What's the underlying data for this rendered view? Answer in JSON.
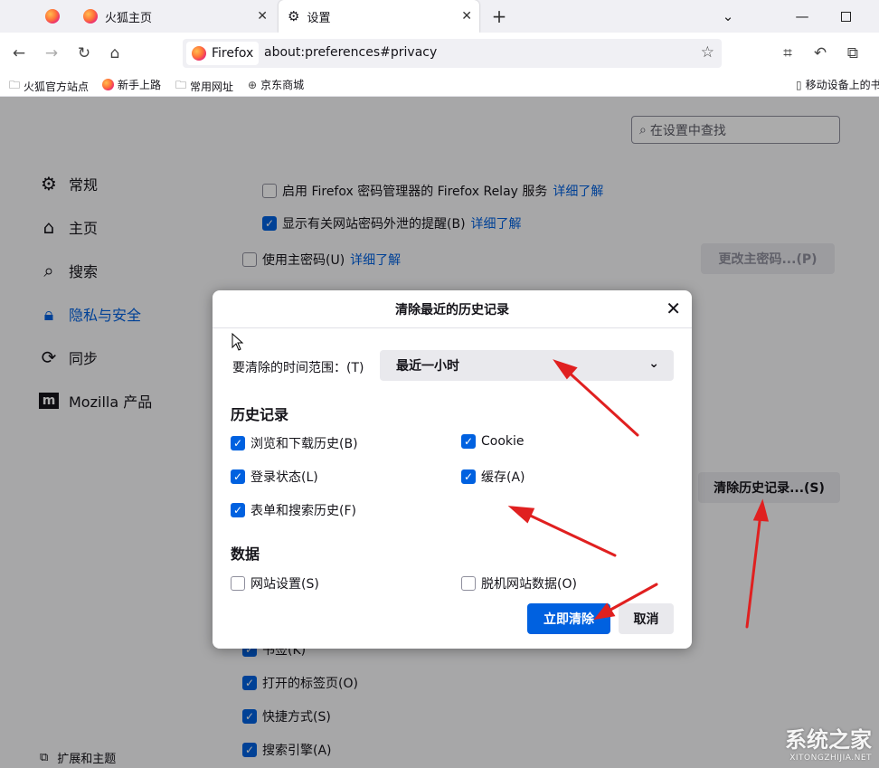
{
  "tabs": {
    "tab1_title": "火狐主页",
    "tab2_title": "设置"
  },
  "nav": {
    "identity_label": "Firefox",
    "url": "about:preferences#privacy"
  },
  "bookmarks": {
    "items": [
      "火狐官方站点",
      "新手上路",
      "常用网址",
      "京东商城"
    ],
    "mobile": "移动设备上的书签"
  },
  "page": {
    "search_placeholder": "在设置中查找",
    "categories": [
      "常规",
      "主页",
      "搜索",
      "隐私与安全",
      "同步",
      "Mozilla 产品"
    ],
    "extensions_label": "扩展和主题",
    "relay_label": "启用 Firefox 密码管理器的 Firefox Relay 服务",
    "breach_label": "显示有关网站密码外泄的提醒(B)",
    "primary_pw_label": "使用主密码(U)",
    "learn_more": "详细了解",
    "change_primary_pw": "更改主密码...(P)",
    "clear_history_btn": "清除历史记录...(S)",
    "bottom_items": [
      "书签(K)",
      "打开的标签页(O)",
      "快捷方式(S)",
      "搜索引擎(A)"
    ]
  },
  "dialog": {
    "title": "清除最近的历史记录",
    "range_label": "要清除的时间范围：(T)",
    "range_value": "最近一小时",
    "history_heading": "历史记录",
    "history_items": [
      "浏览和下载历史(B)",
      "Cookie",
      "登录状态(L)",
      "缓存(A)",
      "表单和搜索历史(F)"
    ],
    "data_heading": "数据",
    "data_items": [
      "网站设置(S)",
      "脱机网站数据(O)"
    ],
    "clear_now": "立即清除",
    "cancel": "取消"
  },
  "colors": {
    "accent": "#0061e0",
    "arrow": "#e02020"
  },
  "watermark": {
    "line1": "系统之家",
    "line2": "XITONGZHIJIA.NET"
  }
}
